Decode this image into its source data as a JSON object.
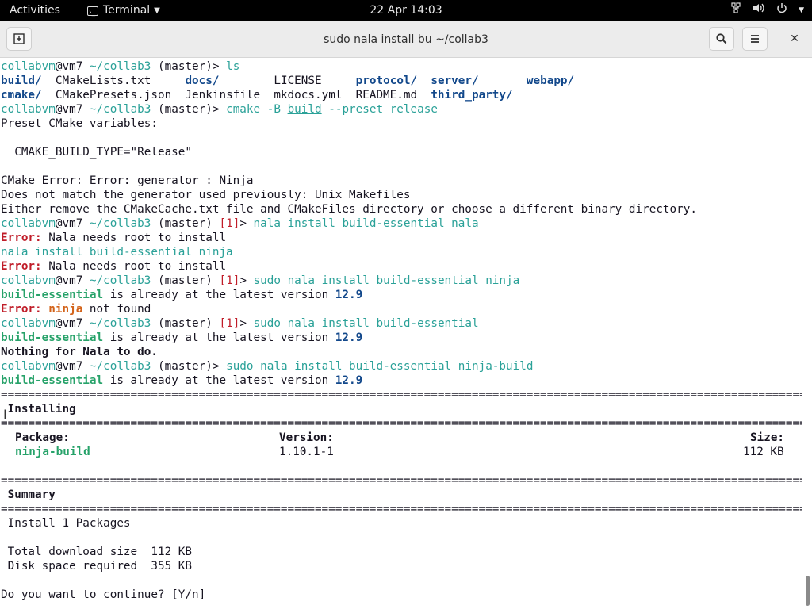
{
  "topbar": {
    "activities": "Activities",
    "app_name": "Terminal",
    "clock": "22 Apr  14:03",
    "tray": {
      "network_icon": "network-icon",
      "volume_icon": "volume-icon",
      "power_icon": "power-icon"
    }
  },
  "window": {
    "title": "sudo nala install bu ~/collab3",
    "new_tab_icon": "new-tab-icon",
    "search_icon": "search-icon",
    "menu_icon": "hamburger-menu-icon",
    "close_icon": "close-icon"
  },
  "colors": {
    "prompt": "#2aa198",
    "error": "#c01c28",
    "success": "#26a269",
    "directory": "#12488b",
    "warning": "#d3631a"
  },
  "terminal": {
    "prompt_user": "collabvm",
    "prompt_host": "@vm7",
    "prompt_path": "~/collab3",
    "prompt_branch": "(master)",
    "prompt_status": "[1]",
    "prompt_end": ">",
    "line1_cmd": "ls",
    "ls": [
      "build/",
      "CMakeLists.txt",
      "docs/",
      "LICENSE",
      "protocol/",
      "server/",
      "webapp/",
      "cmake/",
      "CMakePresets.json",
      "Jenkinsfile",
      "mkdocs.yml",
      "README.md",
      "third_party/"
    ],
    "cmake_cmd": "cmake",
    "cmake_flag": "-B",
    "cmake_dir": "build",
    "cmake_rest": "--preset release",
    "preset_header": "Preset CMake variables:",
    "preset_var": "  CMAKE_BUILD_TYPE=\"Release\"",
    "cmake_err1": "CMake Error: Error: generator : Ninja",
    "cmake_err2": "Does not match the generator used previously: Unix Makefiles",
    "cmake_err3": "Either remove the CMakeCache.txt file and CMakeFiles directory or choose a different binary directory.",
    "nala_cmd": "nala",
    "nala_args1": "install build-essential nala",
    "error_label": "Error:",
    "needs_root": " Nala needs root to install",
    "nala_args2": "install build-essential ninja",
    "sudo": "sudo",
    "pkg_build_essential": "build-essential",
    "latest_text": " is already at the latest version ",
    "latest_version": "12.9",
    "ninja": "ninja",
    "not_found": " not found",
    "nala_args3": "install build-essential",
    "nothing": "Nothing for Nala to do.",
    "nala_args4": "install build-essential ninja-build",
    "installing": " Installing",
    "col_package": "Package:",
    "col_version": "Version:",
    "col_size": "Size:",
    "pkg_name": "ninja-build",
    "pkg_version": "1.10.1-1",
    "pkg_size": "112 KB",
    "summary": " Summary",
    "install_count": " Install 1 Packages",
    "download_size": " Total download size  112 KB",
    "disk_space": " Disk space required  355 KB",
    "continue_prompt": "Do you want to continue? [Y/n]"
  }
}
